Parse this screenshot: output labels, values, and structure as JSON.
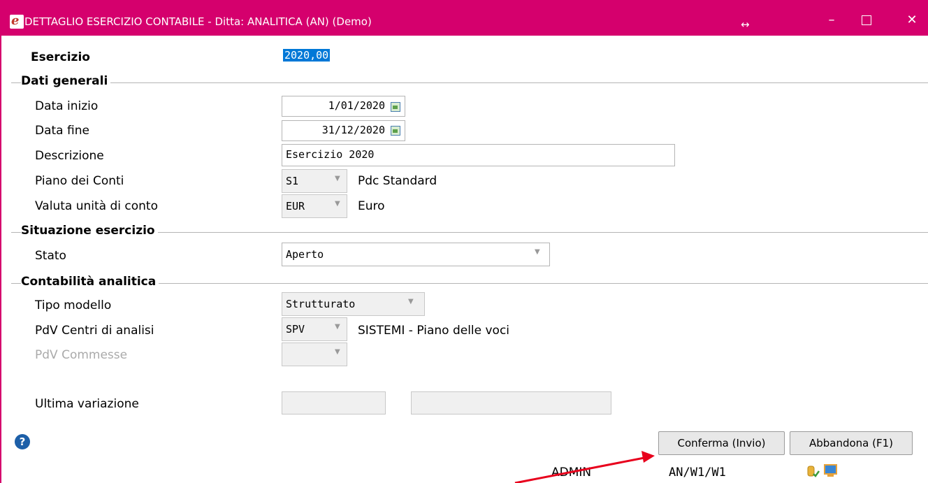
{
  "window": {
    "title": "DETTAGLIO ESERCIZIO CONTABILE - Ditta: ANALITICA (AN)  (Demo)",
    "resize_glyph": "↔",
    "minimize": "–",
    "close": "✕"
  },
  "esercizio": {
    "label": "Esercizio",
    "value": "2020,00"
  },
  "dati_generali": {
    "title": "Dati generali",
    "data_inizio": {
      "label": "Data inizio",
      "value": "1/01/2020"
    },
    "data_fine": {
      "label": "Data fine",
      "value": "31/12/2020"
    },
    "descrizione": {
      "label": "Descrizione",
      "value": "Esercizio 2020"
    },
    "piano_conti": {
      "label": "Piano dei Conti",
      "code": "S1",
      "text": "Pdc Standard"
    },
    "valuta": {
      "label": "Valuta unità di conto",
      "code": "EUR",
      "text": "Euro"
    }
  },
  "situazione": {
    "title": "Situazione esercizio",
    "stato": {
      "label": "Stato",
      "value": "Aperto"
    }
  },
  "analitica": {
    "title": "Contabilità analitica",
    "tipo_modello": {
      "label": "Tipo modello",
      "value": "Strutturato"
    },
    "pdv_centri": {
      "label": "PdV Centri di analisi",
      "code": "SPV",
      "text": "SISTEMI - Piano delle voci"
    },
    "pdv_commesse": {
      "label": "PdV Commesse",
      "code": ""
    }
  },
  "ultima_variazione": {
    "label": "Ultima variazione",
    "value1": "",
    "value2": ""
  },
  "buttons": {
    "confirm": "Conferma (Invio)",
    "cancel": "Abbandona (F1)"
  },
  "help_glyph": "?",
  "status": {
    "user": "ADMIN",
    "location": "AN/W1/W1"
  },
  "colors": {
    "titlebar": "#d5006d",
    "annotation_arrow": "#e8001c"
  }
}
